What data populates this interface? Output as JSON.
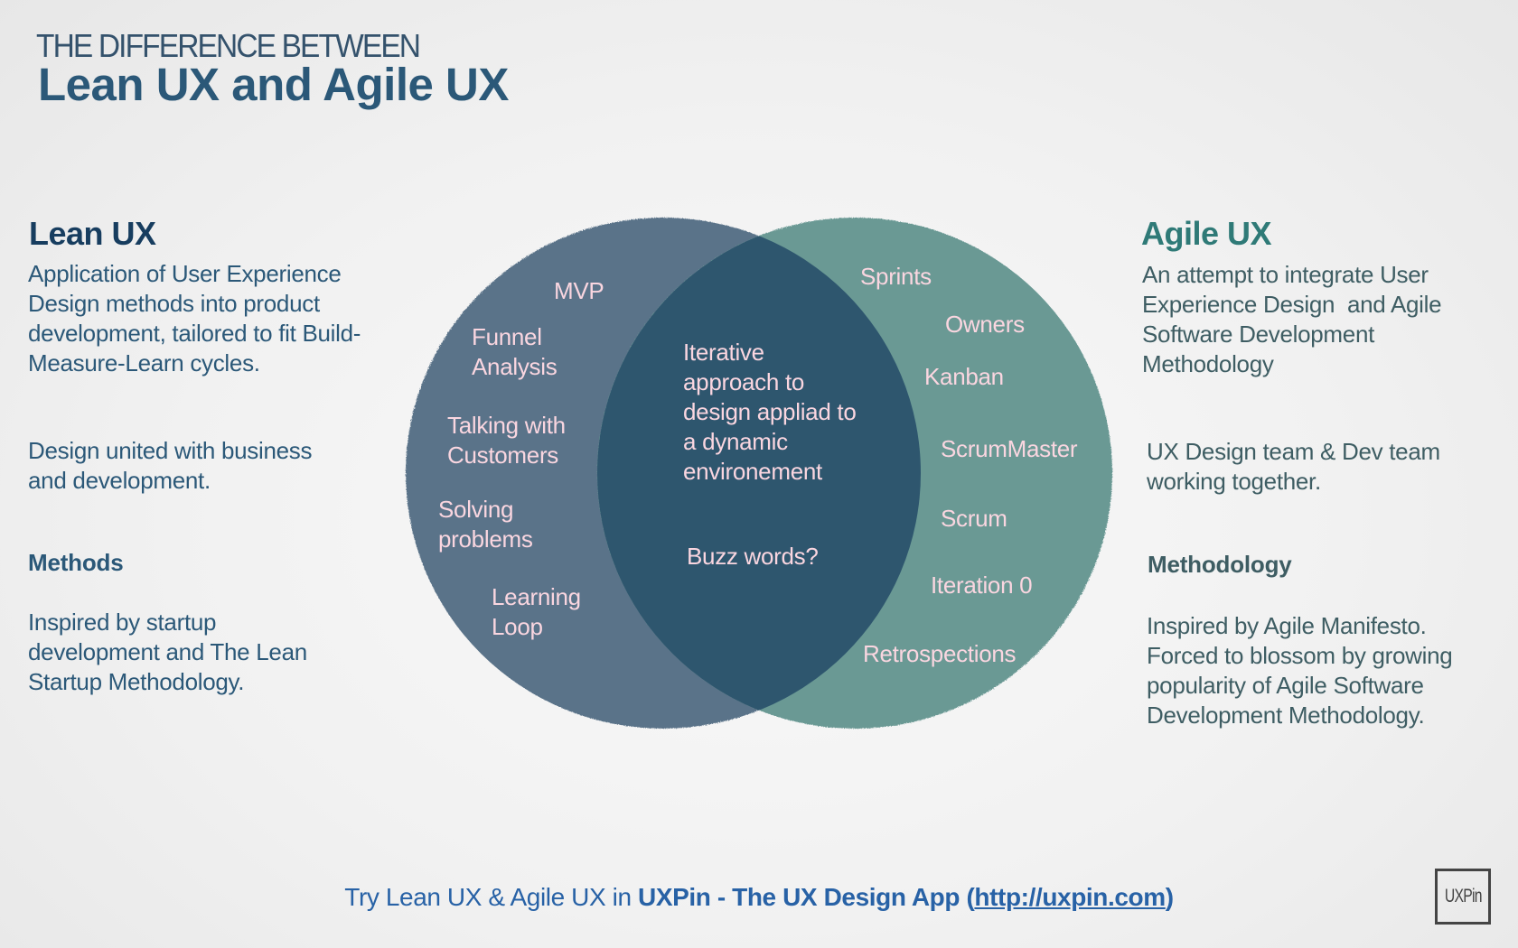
{
  "header": {
    "kicker": "THE DIFFERENCE BETWEEN",
    "title": "Lean UX and Agile UX"
  },
  "lean": {
    "heading": "Lean UX",
    "description_lines": [
      "Application of User Experience",
      "Design methods into product",
      "development, tailored to fit Build-",
      "Measure-Learn cycles."
    ],
    "team_lines": [
      "Design united with business",
      "and development."
    ],
    "methods_heading": "Methods",
    "methods_lines": [
      "Inspired by startup",
      "development and The Lean",
      "Startup Methodology."
    ]
  },
  "agile": {
    "heading": "Agile UX",
    "description_lines": [
      "An attempt to integrate User",
      "Experience Design  and Agile",
      "Software Development",
      "Methodology"
    ],
    "team_lines": [
      "UX Design team & Dev team",
      "working together."
    ],
    "methods_heading": "Methodology",
    "methods_lines": [
      "Inspired by Agile Manifesto.",
      "Forced to blossom by growing",
      "popularity of Agile Software",
      "Development Methodology."
    ]
  },
  "venn": {
    "colors": {
      "lean": "#5a7389",
      "agile": "#6a9994",
      "overlap": "#2e566e",
      "label": "#fad6e0"
    },
    "lean_only": [
      {
        "lines": [
          "MVP"
        ]
      },
      {
        "lines": [
          "Funnel",
          "Analysis"
        ]
      },
      {
        "lines": [
          "Talking with",
          "Customers"
        ]
      },
      {
        "lines": [
          "Solving",
          "problems"
        ]
      },
      {
        "lines": [
          "Learning",
          "Loop"
        ]
      }
    ],
    "overlap": [
      {
        "lines": [
          "Iterative",
          "approach to",
          "design appliad to",
          "a dynamic",
          "environement"
        ]
      },
      {
        "lines": [
          "Buzz words?"
        ]
      }
    ],
    "agile_only": [
      {
        "lines": [
          "Sprints"
        ]
      },
      {
        "lines": [
          "Owners"
        ]
      },
      {
        "lines": [
          "Kanban"
        ]
      },
      {
        "lines": [
          "ScrumMaster"
        ]
      },
      {
        "lines": [
          "Scrum"
        ]
      },
      {
        "lines": [
          "Iteration 0"
        ]
      },
      {
        "lines": [
          "Retrospections"
        ]
      }
    ]
  },
  "footer": {
    "prefix": "Try Lean UX & Agile UX in ",
    "app": "UXPin - The UX Design App (",
    "link": "http://uxpin.com",
    "suffix": ")"
  },
  "logo": {
    "text": "UXPin"
  }
}
